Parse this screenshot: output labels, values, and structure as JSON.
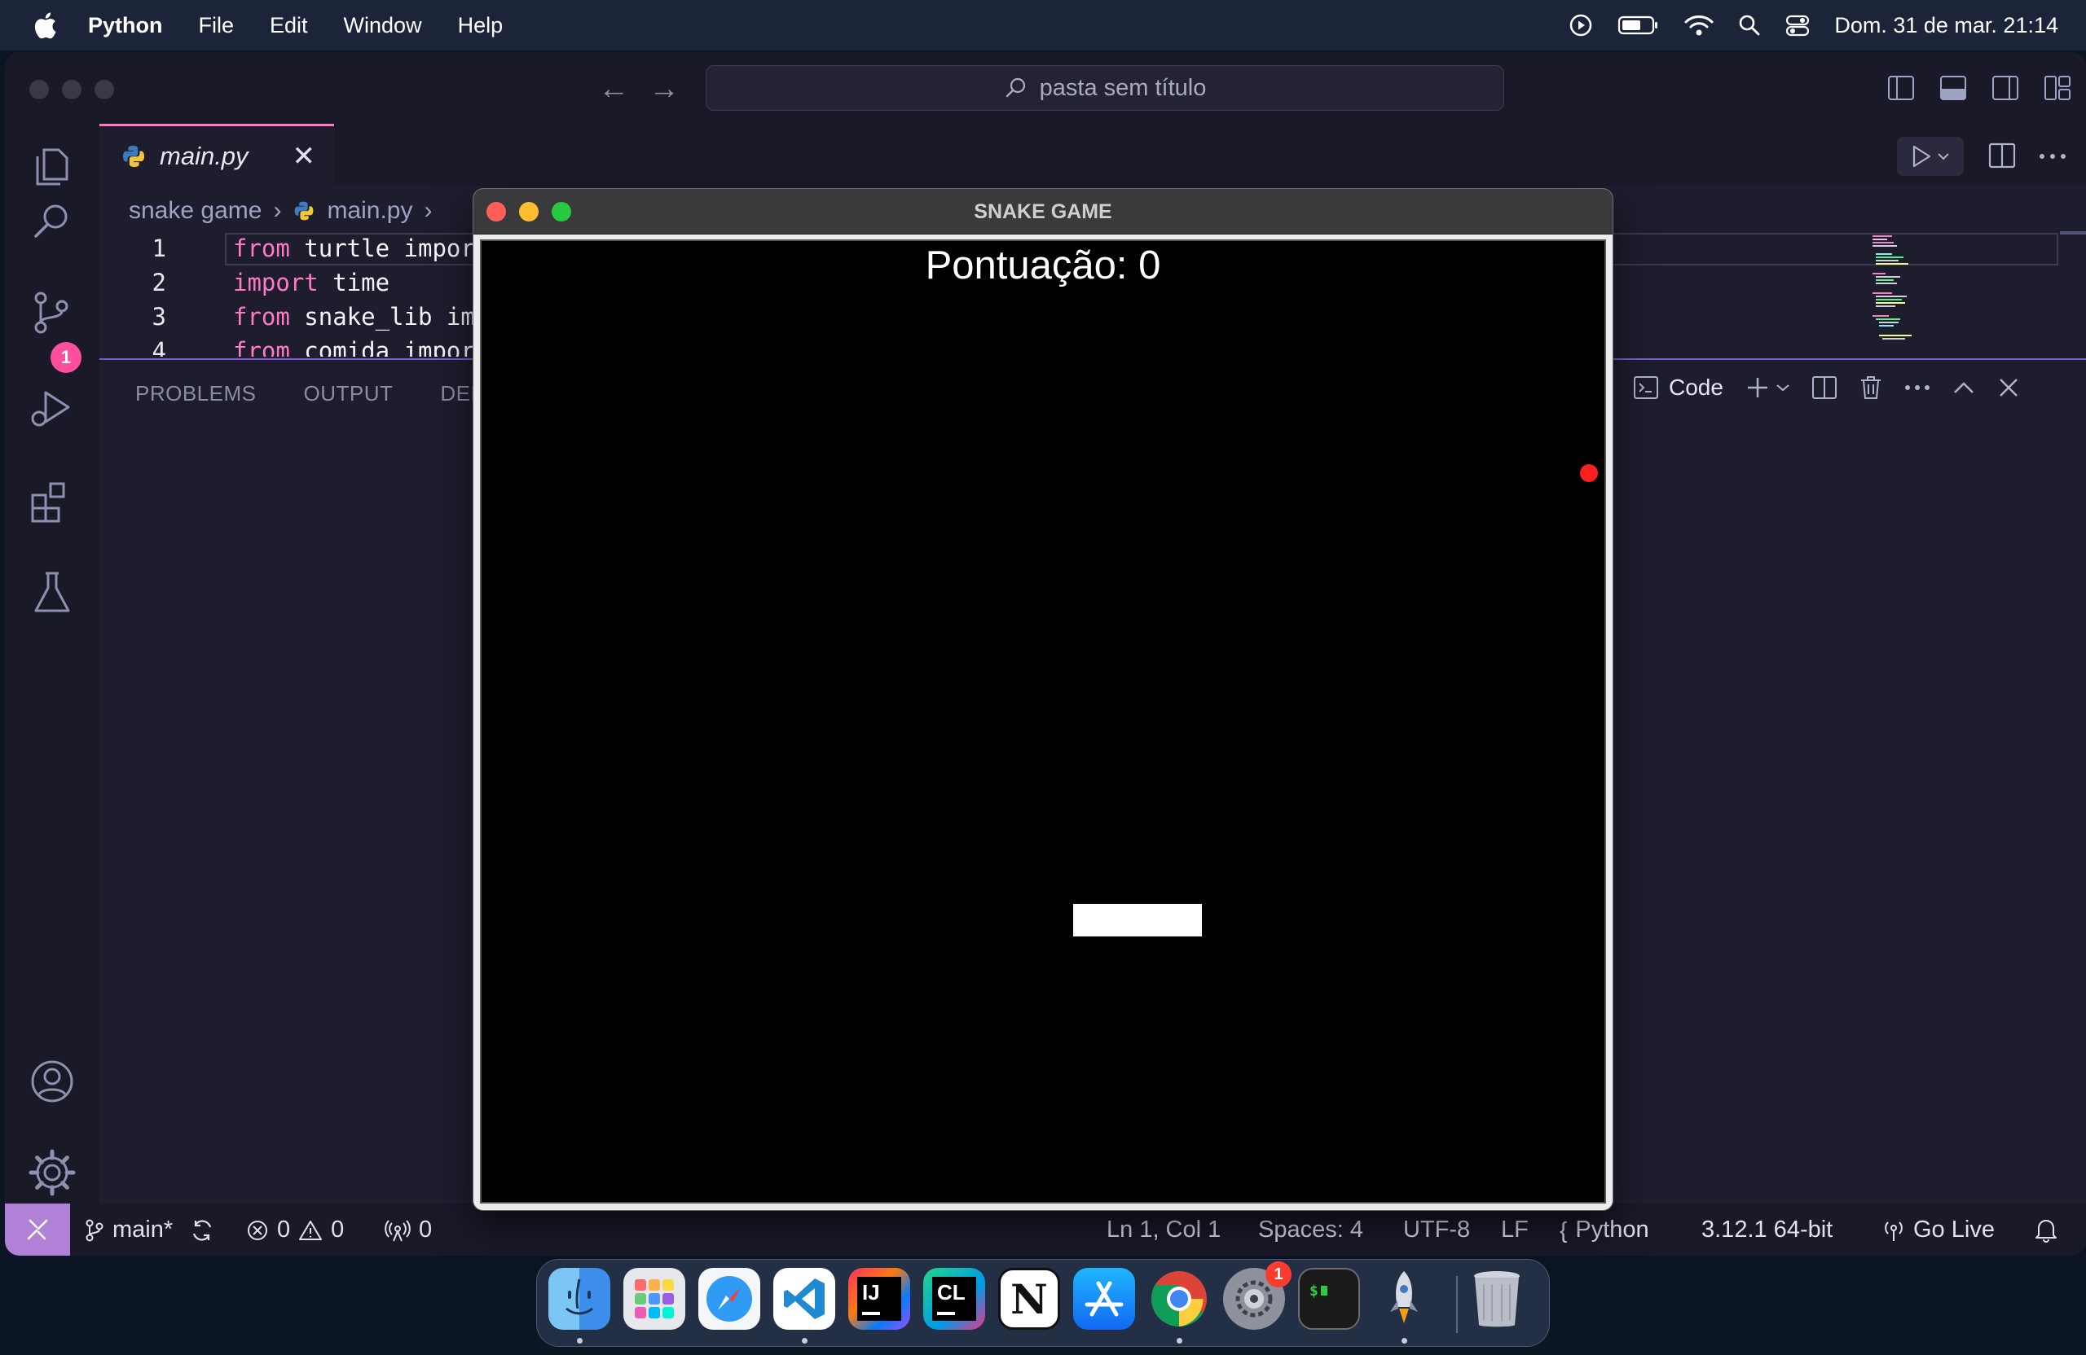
{
  "menubar": {
    "app_name": "Python",
    "items": [
      "File",
      "Edit",
      "Window",
      "Help"
    ],
    "datetime": "Dom. 31 de mar.  21:14"
  },
  "vscode": {
    "search_placeholder": "pasta sem título",
    "tab": {
      "label": "main.py",
      "close": "✕"
    },
    "breadcrumb": {
      "folder": "snake game",
      "file": "main.py"
    },
    "code_lines": [
      {
        "num": "1",
        "kw": "from",
        "text": " turtle import"
      },
      {
        "num": "2",
        "kw": "import",
        "text": " time"
      },
      {
        "num": "3",
        "kw": "from",
        "text": " snake_lib imp"
      },
      {
        "num": "4",
        "kw": "from",
        "text": " comida import"
      }
    ],
    "activity_badge": "1",
    "panel_tabs": [
      "PROBLEMS",
      "OUTPUT",
      "DEB"
    ],
    "terminal_label": "Code",
    "status": {
      "branch": "main*",
      "errors": "0",
      "warnings": "0",
      "ports": "0",
      "position": "Ln 1, Col 1",
      "spaces": "Spaces: 4",
      "encoding": "UTF-8",
      "eol": "LF",
      "language": "Python",
      "interpreter": "3.12.1 64-bit",
      "go_live": "Go Live"
    }
  },
  "game": {
    "title": "SNAKE GAME",
    "score_text": "Pontuação: 0"
  },
  "dock": {
    "settings_badge": "1",
    "intellij_label": "IJ",
    "clion_label": "CL",
    "notion_label": "N"
  },
  "colors": {
    "accent": "#ff79c6",
    "statusbar_remote": "#b180d7",
    "food": "#ff1f1f"
  }
}
